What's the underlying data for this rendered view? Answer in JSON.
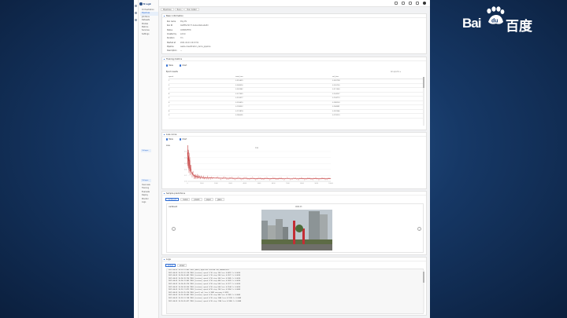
{
  "watermark": {
    "left_text": "Bai",
    "right_text": "百度",
    "paw_glyph": "du",
    "color": "#ffffff"
  },
  "app": {
    "brand": "N agk"
  },
  "sidebar": {
    "items": [
      {
        "label": "Orchestration",
        "active": false
      },
      {
        "label": "Pipelines",
        "active": true
      },
      {
        "label": "Job Runs",
        "active": false
      },
      {
        "label": "Datasets",
        "active": false
      },
      {
        "label": "Models",
        "active": false
      },
      {
        "label": "Metrics",
        "active": false
      },
      {
        "label": "Services",
        "active": false
      },
      {
        "label": "Settings",
        "active": false
      }
    ],
    "collapse_label": "Collapse",
    "items2": [
      {
        "label": "Overview"
      },
      {
        "label": "Training"
      },
      {
        "label": "Evaluate"
      },
      {
        "label": "Deploy"
      },
      {
        "label": "Monitor"
      },
      {
        "label": "Logs"
      }
    ],
    "collapse2_label": "Collapse"
  },
  "breadcrumb": [
    "Pipelines",
    "Runs",
    "Run detail"
  ],
  "basic": {
    "title": "Basic information",
    "fields": [
      {
        "label": "Run name",
        "value": "Poly-tfx"
      },
      {
        "label": "Run ID",
        "value": "0a0f5fe7b7c7-4a1a-b4a6-a2e8d"
      },
      {
        "label": "Status",
        "value": "COMPLETED"
      },
      {
        "label": "Created by",
        "value": "admin"
      },
      {
        "label": "Duration",
        "value": "7m"
      },
      {
        "label": "Started at",
        "value": "2021-04-01 10:23:51"
      },
      {
        "label": "Pipeline",
        "value": "waste-classification_demo_pipeline"
      },
      {
        "label": "Description",
        "value": "—"
      }
    ]
  },
  "table_section": {
    "title": "Training metrics",
    "radio": [
      {
        "label": "Table",
        "checked": true
      },
      {
        "label": "Chart",
        "checked": false
      }
    ],
    "sub_title": "Epoch results",
    "filter_label": "All epochs ▾",
    "columns": [
      "epoch",
      "train_loss",
      "val_loss"
    ],
    "rows": [
      [
        "1",
        "0.316429",
        "0.269798"
      ],
      [
        "2",
        "0.268516",
        "0.226730"
      ],
      [
        "3",
        "0.243342",
        "0.211560"
      ],
      [
        "4",
        "0.227659",
        "0.204157"
      ],
      [
        "5",
        "0.214377",
        "0.194773"
      ],
      [
        "6",
        "0.205410",
        "0.188103"
      ],
      [
        "7",
        "0.198322",
        "0.184581"
      ],
      [
        "8",
        "0.191874",
        "0.181246"
      ],
      [
        "9",
        "0.186035",
        "0.178113"
      ]
    ]
  },
  "chart_section": {
    "title": "Loss curve",
    "radio": [
      {
        "label": "Table",
        "checked": false
      },
      {
        "label": "Chart",
        "checked": true
      }
    ],
    "chart_label": "Loss",
    "legend": "loss"
  },
  "chart_data": {
    "type": "line",
    "title": "",
    "xlabel": "",
    "ylabel": "",
    "ylim": [
      0,
      0.5
    ],
    "xlim": [
      0,
      10000
    ],
    "series": [
      {
        "name": "loss",
        "color": "#c43a3a",
        "x": [
          0,
          50,
          100,
          150,
          200,
          300,
          400,
          500,
          650,
          800,
          1000,
          1300,
          1600,
          2000,
          2500,
          3000,
          3500,
          4000,
          4500,
          5000,
          5500,
          6000,
          6500,
          7000,
          7500,
          8000,
          8500,
          9000,
          9500,
          10000
        ],
        "y": [
          0.48,
          0.42,
          0.35,
          0.28,
          0.22,
          0.15,
          0.11,
          0.09,
          0.08,
          0.07,
          0.065,
          0.06,
          0.058,
          0.055,
          0.053,
          0.052,
          0.05,
          0.05,
          0.049,
          0.048,
          0.048,
          0.047,
          0.047,
          0.046,
          0.046,
          0.045,
          0.045,
          0.045,
          0.044,
          0.044
        ]
      }
    ],
    "grid": true
  },
  "image_section": {
    "title": "Sample predictions",
    "tabs": [
      {
        "label": "cardboard",
        "on": true
      },
      {
        "label": "metal",
        "on": false
      },
      {
        "label": "plastic",
        "on": false
      },
      {
        "label": "paper",
        "on": false
      },
      {
        "label": "glass",
        "on": false
      }
    ],
    "sub_label": "cardboard",
    "caption": "000123",
    "prev": "‹",
    "next": "›"
  },
  "log_section": {
    "title": "Logs",
    "tabs": [
      {
        "label": "stdout",
        "on": true
      },
      {
        "label": "stderr",
        "on": false
      }
    ],
    "lines": [
      "2021-04-01 10:23:51,902 INFO  [main] pipeline started  run_id=0a0f5fe7",
      "2021-04-01 10:23:52,118 INFO  [trainer] epoch 1/10  step 100  loss 0.4812  lr 0.0010",
      "2021-04-01 10:24:05,441 INFO  [trainer] epoch 1/10  step 200  loss 0.3527  lr 0.0010",
      "2021-04-01 10:24:18,736 INFO  [trainer] epoch 2/10  step 300  loss 0.2685  lr 0.0010",
      "2021-04-01 10:24:31,902 INFO  [trainer] epoch 2/10  step 400  loss 0.2433  lr 0.0010",
      "2021-04-01 10:24:45,210 INFO  [trainer] epoch 3/10  step 500  loss 0.2277  lr 0.0010",
      "2021-04-01 10:24:58,556 INFO  [trainer] epoch 3/10  step 600  loss 0.2144  lr 0.0010",
      "2021-04-01 10:25:11,873 INFO  [trainer] epoch 4/10  step 700  loss 0.2054  lr 0.0009",
      "2021-04-01 10:25:25,114 INFO  [eval] val_loss 0.1881  accuracy 0.9213",
      "2021-04-01 10:25:38,402 INFO  [trainer] epoch 5/10  step 900  loss 0.1983  lr 0.0009",
      "2021-04-01 10:25:51,768 INFO  [trainer] epoch 5/10  step 1000 loss 0.1919  lr 0.0009",
      "2021-04-01 10:26:05,027 INFO  [trainer] epoch 6/10  step 1100 loss 0.1860  lr 0.0008"
    ]
  }
}
